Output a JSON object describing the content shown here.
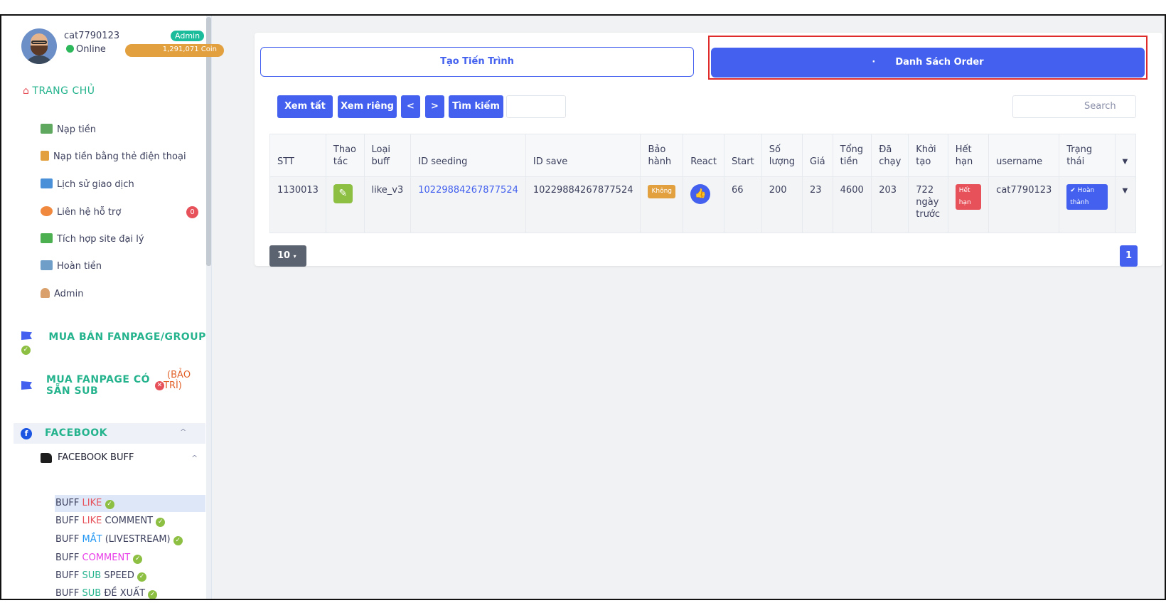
{
  "user": {
    "name": "cat7790123",
    "role_badge": "Admin",
    "status": "Online",
    "balance": "1,291,071 Coin"
  },
  "nav": {
    "home": "TRANG CHỦ",
    "items": [
      {
        "label": "Nạp tiền",
        "icon": "money-icon"
      },
      {
        "label": "Nạp tiền bằng thẻ điện thoại",
        "icon": "phone-card-icon"
      },
      {
        "label": "Lịch sử giao dịch",
        "icon": "chart-icon"
      },
      {
        "label": "Liên hệ hỗ trợ",
        "icon": "support-icon"
      },
      {
        "label": "Tích hợp site đại lý",
        "icon": "store-icon"
      },
      {
        "label": "Hoàn tiền",
        "icon": "refund-icon"
      },
      {
        "label": "Admin",
        "icon": "user-icon"
      }
    ],
    "support_count": "0",
    "section_fanpage_group": "MUA BÁN FANPAGE/GROUP",
    "section_fanpage_sub_1": "MUA FANPAGE CÓ",
    "section_fanpage_sub_2": "SẴN SUB",
    "maintenance_1": "(BẢO",
    "maintenance_2": "TRÌ)",
    "facebook": "FACEBOOK",
    "facebook_buff": "FACEBOOK BUFF",
    "buff_items": [
      {
        "prefix": "BUFF ",
        "highlight": "LIKE",
        "suffix": "",
        "color": "#e7515a"
      },
      {
        "prefix": "BUFF ",
        "highlight": "LIKE",
        "suffix": " COMMENT",
        "color": "#e7515a"
      },
      {
        "prefix": "BUFF ",
        "highlight": "MẮT",
        "suffix": " (LIVESTREAM)",
        "color": "#2196f3"
      },
      {
        "prefix": "BUFF ",
        "highlight": "COMMENT",
        "suffix": "",
        "color": "#e83ee8"
      },
      {
        "prefix": "BUFF ",
        "highlight": "SUB",
        "suffix": " SPEED",
        "color": "#25b38e"
      },
      {
        "prefix": "BUFF ",
        "highlight": "SUB",
        "suffix": " ĐỀ XUẤT",
        "color": "#25b38e"
      }
    ]
  },
  "tabs": {
    "create": "Tạo Tiến Trình",
    "list": "Danh Sách Order",
    "list_dot": "·"
  },
  "toolbar": {
    "view_all": "Xem tất cả",
    "view_own": "Xem riêng",
    "prev": "<",
    "next": ">",
    "search_btn": "Tìm kiếm",
    "search_placeholder": "Search"
  },
  "table": {
    "headers": [
      "STT",
      "Thao tác",
      "Loại buff",
      "ID seeding",
      "ID save",
      "Bảo hành",
      "React",
      "Start",
      "Số lượng",
      "Giá",
      "Tổng tiền",
      "Đã chạy",
      "Khởi tạo",
      "Hết hạn",
      "username",
      "Trạng thái"
    ],
    "row": {
      "stt": "1130013",
      "type": "like_v3",
      "id_seeding": "10229884267877524",
      "id_save": "10229884267877524",
      "warranty": "Không",
      "start": "66",
      "quantity": "200",
      "price": "23",
      "total": "4600",
      "ran": "203",
      "created": "722 ngày trước",
      "expired": "Hết hạn",
      "username": "cat7790123",
      "status": "✔ Hoàn thành"
    }
  },
  "pagination": {
    "page_size": "10",
    "current_page": "1"
  }
}
